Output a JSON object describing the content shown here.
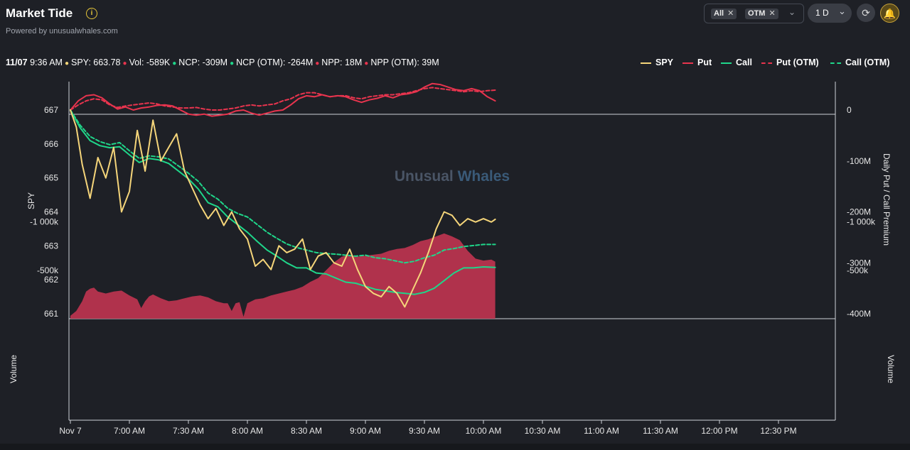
{
  "header": {
    "title": "Market Tide",
    "subtitle": "Powered by unusualwhales.com",
    "info_icon": "info-icon",
    "filters": [
      "All",
      "OTM"
    ],
    "range": "1 D",
    "refresh_icon": "refresh-icon",
    "bell_icon": "bell-icon"
  },
  "stats": {
    "date": "11/07",
    "time": "9:36 AM",
    "spy": "SPY: 663.78",
    "vol": "Vol: -589K",
    "ncp": "NCP: -309M",
    "ncp_otm": "NCP (OTM): -264M",
    "npp": "NPP: 18M",
    "npp_otm": "NPP (OTM): 39M"
  },
  "legend": [
    {
      "label": "SPY",
      "color": "#f5d57a",
      "dash": false
    },
    {
      "label": "Put",
      "color": "#e8344e",
      "dash": false
    },
    {
      "label": "Call",
      "color": "#1fd68a",
      "dash": false
    },
    {
      "label": "Put (OTM)",
      "color": "#e8344e",
      "dash": true
    },
    {
      "label": "Call (OTM)",
      "color": "#1fd68a",
      "dash": true
    }
  ],
  "watermark": {
    "part1": "Unusual",
    "part2": "Whales"
  },
  "chart_data": {
    "type": "line",
    "x": [
      "Nov 7",
      "7:00 AM",
      "7:30 AM",
      "8:00 AM",
      "8:30 AM",
      "9:00 AM",
      "9:30 AM",
      "10:00 AM",
      "10:30 AM",
      "11:00 AM",
      "11:30 AM",
      "12:00 PM",
      "12:30 PM"
    ],
    "y_left_label": "SPY",
    "y_left_ticks": [
      "661",
      "662",
      "663",
      "664",
      "665",
      "666",
      "667"
    ],
    "y_left_range": [
      661,
      667.2
    ],
    "y_right_label": "Daily Put / Call Premium",
    "y_right_ticks": [
      "0",
      "-100M",
      "-200M",
      "-300M",
      "-400M"
    ],
    "y_right_range_millions": [
      -400,
      10
    ],
    "volume_label": "Volume",
    "volume_ticks": [
      "-500k",
      "-1 000k"
    ],
    "series": [
      {
        "name": "SPY",
        "axis": "left",
        "style": "solid",
        "color": "#f5d57a",
        "time_min": [
          0,
          3,
          6,
          10,
          14,
          18,
          22,
          26,
          30,
          34,
          38,
          42,
          46,
          50,
          54,
          58,
          62,
          66,
          70,
          74,
          78,
          82,
          86,
          90,
          94,
          98,
          102,
          106,
          110,
          114,
          118,
          122,
          126,
          130,
          134,
          138,
          142,
          146,
          150,
          154,
          158,
          162,
          166,
          170,
          174,
          178,
          182,
          186,
          190,
          194,
          198,
          202,
          206,
          210,
          214,
          216
        ],
        "values": [
          667.0,
          666.5,
          665.4,
          664.4,
          665.6,
          665.0,
          665.9,
          664.0,
          664.6,
          666.4,
          665.2,
          666.7,
          665.5,
          665.9,
          666.3,
          665.2,
          664.7,
          664.2,
          663.8,
          664.1,
          663.6,
          664.0,
          663.5,
          663.2,
          662.4,
          662.6,
          662.3,
          663.0,
          662.8,
          662.9,
          663.2,
          662.3,
          662.7,
          662.8,
          662.5,
          662.4,
          662.9,
          662.3,
          661.8,
          661.6,
          661.5,
          661.8,
          661.6,
          661.2,
          661.7,
          662.2,
          662.8,
          663.5,
          664.0,
          663.9,
          663.6,
          663.8,
          663.7,
          663.8,
          663.7,
          663.78
        ]
      },
      {
        "name": "Call",
        "axis": "right",
        "style": "solid",
        "color": "#1fd68a",
        "time_min": [
          0,
          5,
          10,
          15,
          20,
          25,
          30,
          35,
          40,
          45,
          50,
          55,
          60,
          65,
          70,
          75,
          80,
          85,
          90,
          95,
          100,
          105,
          110,
          115,
          120,
          125,
          130,
          135,
          140,
          145,
          150,
          155,
          160,
          165,
          170,
          175,
          180,
          185,
          190,
          195,
          200,
          205,
          210,
          216
        ],
        "values_millions": [
          0,
          -35,
          -60,
          -70,
          -74,
          -72,
          -88,
          -103,
          -95,
          -98,
          -105,
          -120,
          -135,
          -155,
          -182,
          -190,
          -210,
          -225,
          -240,
          -258,
          -275,
          -287,
          -300,
          -310,
          -310,
          -320,
          -322,
          -330,
          -338,
          -340,
          -346,
          -352,
          -355,
          -358,
          -360,
          -362,
          -358,
          -350,
          -335,
          -320,
          -310,
          -310,
          -308,
          -309
        ]
      },
      {
        "name": "Call (OTM)",
        "axis": "right",
        "style": "dashed",
        "color": "#1fd68a",
        "time_min": [
          0,
          5,
          10,
          15,
          20,
          25,
          30,
          35,
          40,
          45,
          50,
          55,
          60,
          65,
          70,
          75,
          80,
          85,
          90,
          95,
          100,
          105,
          110,
          115,
          120,
          125,
          130,
          135,
          140,
          145,
          150,
          155,
          160,
          165,
          170,
          175,
          180,
          185,
          190,
          195,
          200,
          205,
          210,
          216
        ],
        "values_millions": [
          0,
          -30,
          -52,
          -62,
          -68,
          -64,
          -80,
          -95,
          -90,
          -92,
          -96,
          -110,
          -124,
          -140,
          -163,
          -175,
          -193,
          -203,
          -210,
          -225,
          -240,
          -252,
          -263,
          -270,
          -275,
          -280,
          -282,
          -283,
          -285,
          -287,
          -285,
          -290,
          -292,
          -296,
          -300,
          -297,
          -290,
          -285,
          -275,
          -272,
          -268,
          -266,
          -264,
          -264
        ]
      },
      {
        "name": "Put",
        "axis": "right",
        "style": "solid",
        "color": "#e8344e",
        "time_min": [
          0,
          4,
          8,
          12,
          16,
          20,
          24,
          28,
          32,
          36,
          40,
          44,
          48,
          52,
          56,
          60,
          64,
          68,
          72,
          76,
          80,
          84,
          88,
          92,
          96,
          100,
          104,
          108,
          112,
          116,
          120,
          124,
          128,
          132,
          136,
          140,
          144,
          148,
          152,
          156,
          160,
          164,
          168,
          172,
          176,
          180,
          184,
          188,
          192,
          196,
          200,
          204,
          208,
          212,
          216
        ],
        "values_millions": [
          0,
          18,
          28,
          30,
          24,
          12,
          2,
          6,
          0,
          4,
          6,
          9,
          10,
          8,
          0,
          -8,
          -10,
          -8,
          -12,
          -10,
          -8,
          -2,
          0,
          -6,
          -10,
          -6,
          -2,
          0,
          10,
          22,
          28,
          26,
          30,
          26,
          28,
          26,
          20,
          15,
          20,
          23,
          28,
          24,
          30,
          32,
          36,
          45,
          52,
          50,
          45,
          40,
          38,
          42,
          38,
          26,
          18
        ]
      },
      {
        "name": "Put (OTM)",
        "axis": "right",
        "style": "dashed",
        "color": "#e8344e",
        "time_min": [
          0,
          4,
          8,
          12,
          16,
          20,
          24,
          28,
          32,
          36,
          40,
          44,
          48,
          52,
          56,
          60,
          64,
          68,
          72,
          76,
          80,
          84,
          88,
          92,
          96,
          100,
          104,
          108,
          112,
          116,
          120,
          124,
          128,
          132,
          136,
          140,
          144,
          148,
          152,
          156,
          160,
          164,
          168,
          172,
          176,
          180,
          184,
          188,
          192,
          196,
          200,
          204,
          208,
          212,
          216
        ],
        "values_millions": [
          0,
          10,
          18,
          22,
          20,
          10,
          5,
          8,
          10,
          12,
          14,
          12,
          8,
          6,
          4,
          4,
          5,
          2,
          0,
          0,
          2,
          4,
          8,
          10,
          8,
          10,
          12,
          18,
          22,
          30,
          34,
          34,
          30,
          26,
          28,
          28,
          24,
          22,
          26,
          28,
          30,
          30,
          32,
          34,
          38,
          42,
          44,
          42,
          40,
          38,
          36,
          38,
          36,
          38,
          39
        ]
      },
      {
        "name": "Volume",
        "axis": "volume",
        "style": "area",
        "color": "#b8344e",
        "time_min": [
          0,
          3,
          6,
          8,
          10,
          12,
          14,
          18,
          22,
          26,
          30,
          34,
          36,
          38,
          40,
          42,
          46,
          50,
          54,
          58,
          62,
          66,
          70,
          74,
          78,
          80,
          82,
          84,
          86,
          88,
          90,
          94,
          98,
          102,
          106,
          110,
          114,
          118,
          122,
          126,
          130,
          134,
          138,
          142,
          146,
          150,
          154,
          158,
          162,
          166,
          170,
          174,
          178,
          182,
          186,
          190,
          194,
          198,
          202,
          206,
          210,
          214,
          216
        ],
        "values_k": [
          -30,
          -80,
          -180,
          -280,
          -310,
          -320,
          -280,
          -260,
          -280,
          -290,
          -240,
          -200,
          -110,
          -180,
          -230,
          -250,
          -210,
          -180,
          -190,
          -210,
          -230,
          -240,
          -220,
          -180,
          -160,
          -160,
          -80,
          -160,
          -170,
          -20,
          -160,
          -200,
          -210,
          -240,
          -260,
          -280,
          -300,
          -330,
          -380,
          -420,
          -500,
          -580,
          -640,
          -660,
          -640,
          -650,
          -660,
          -670,
          -700,
          -720,
          -730,
          -760,
          -800,
          -820,
          -850,
          -880,
          -850,
          -810,
          -700,
          -620,
          -600,
          -610,
          -589
        ]
      }
    ]
  }
}
